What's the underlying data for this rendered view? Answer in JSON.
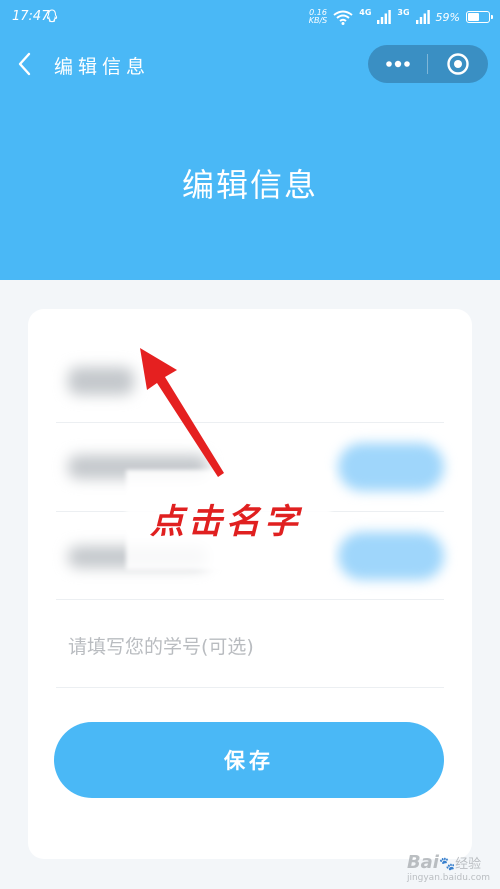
{
  "status_bar": {
    "time": "17:47",
    "net_speed_value": "0.16",
    "net_speed_unit": "KB/S",
    "net_type_1": "4G",
    "net_type_2": "3G",
    "battery_percent": "59%",
    "battery_level": 0.59
  },
  "nav": {
    "title": "编辑信息"
  },
  "page": {
    "title": "编辑信息"
  },
  "form": {
    "student_id_placeholder": "请填写您的学号(可选)",
    "save_label": "保存"
  },
  "annotation": {
    "text": "点击名字"
  },
  "watermark": {
    "logo": "Bai",
    "suffix": "经验",
    "url": "jingyan.baidu.com"
  },
  "colors": {
    "brand": "#4ab8f6",
    "capsule": "#3a8fc3",
    "annotation": "#e02020",
    "background": "#f3f6f9"
  }
}
